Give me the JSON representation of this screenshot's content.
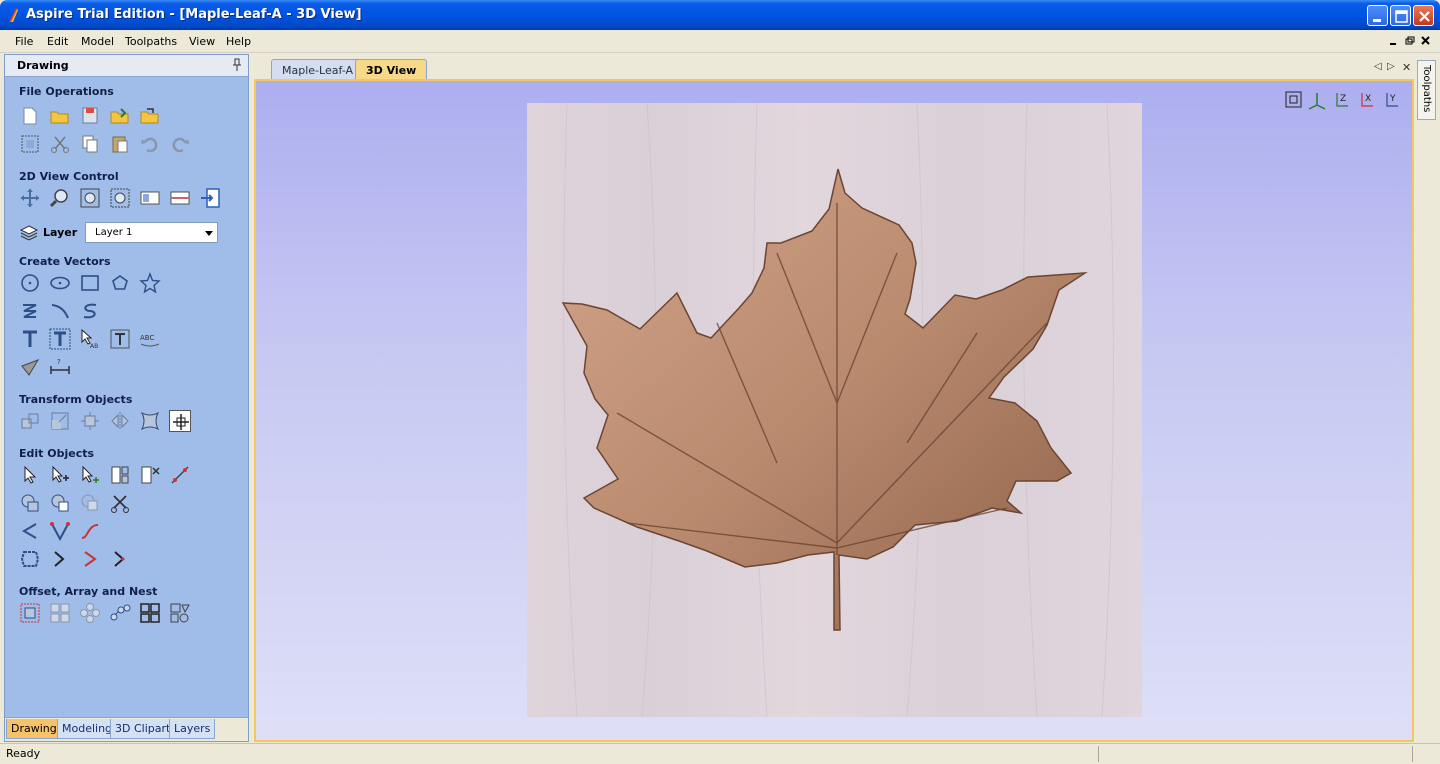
{
  "window": {
    "title": "Aspire Trial Edition - [Maple-Leaf-A - 3D View]"
  },
  "menu": [
    "File",
    "Edit",
    "Model",
    "Toolpaths",
    "View",
    "Help"
  ],
  "panel": {
    "title": "Drawing",
    "sections": {
      "file_operations": "File Operations",
      "view_control": "2D View Control",
      "create_vectors": "Create Vectors",
      "transform": "Transform Objects",
      "edit_objects": "Edit Objects",
      "offset": "Offset, Array and Nest"
    },
    "layer_label": "Layer",
    "layer_value": "Layer 1",
    "bottom_tabs": [
      "Drawing",
      "Modeling",
      "3D Clipart",
      "Layers"
    ]
  },
  "doc_tabs": [
    "Maple-Leaf-A",
    "3D View"
  ],
  "right_tab": "Toolpaths",
  "status": "Ready",
  "colors": {
    "titlebar": "#0054e3",
    "panel_bg": "#a0bce9",
    "active_tab": "#f5c36a",
    "leaf": "#b98a6e"
  }
}
